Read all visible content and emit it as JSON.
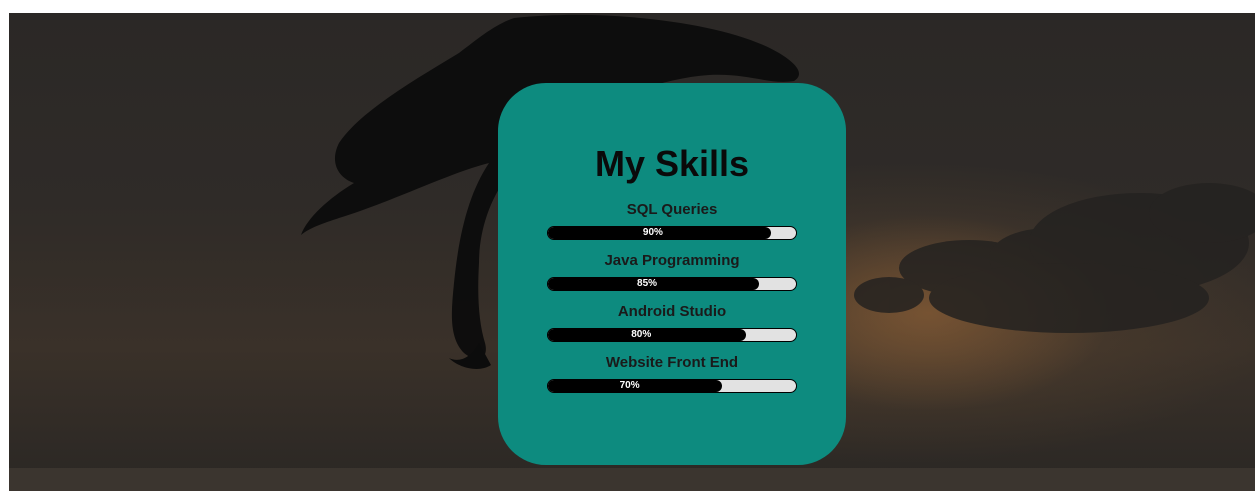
{
  "card": {
    "title": "My Skills",
    "background_color": "#0d8b7f",
    "skills": [
      {
        "label": "SQL Queries",
        "value_text": "90%",
        "value": 90
      },
      {
        "label": "Java Programming",
        "value_text": "85%",
        "value": 85
      },
      {
        "label": "Android Studio",
        "value_text": "80%",
        "value": 80
      },
      {
        "label": "Website Front End",
        "value_text": "70%",
        "value": 70
      }
    ]
  },
  "background": {
    "image": "dolphin-jumping-sunset",
    "overlay_color": "#2b2826"
  }
}
